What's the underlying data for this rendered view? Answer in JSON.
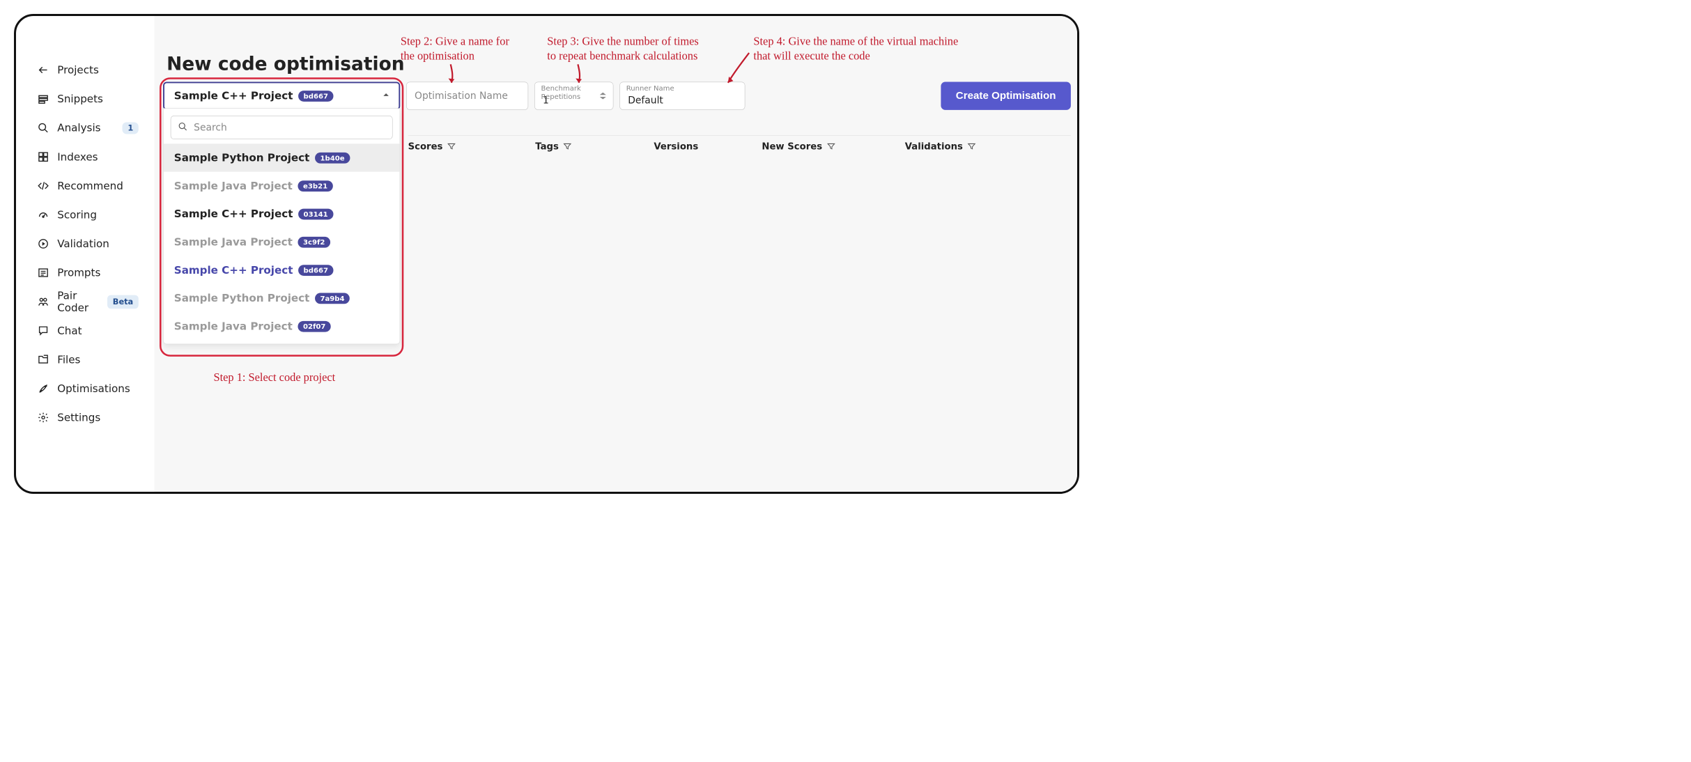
{
  "sidebar": {
    "items": [
      {
        "label": "Projects",
        "icon": "arrow-left"
      },
      {
        "label": "Snippets",
        "icon": "snippets"
      },
      {
        "label": "Analysis",
        "icon": "search",
        "badge": "1"
      },
      {
        "label": "Indexes",
        "icon": "indexes"
      },
      {
        "label": "Recommend",
        "icon": "code"
      },
      {
        "label": "Scoring",
        "icon": "gauge"
      },
      {
        "label": "Validation",
        "icon": "play-circle"
      },
      {
        "label": "Prompts",
        "icon": "prompts"
      },
      {
        "label": "Pair Coder",
        "icon": "pair",
        "beta": "Beta"
      },
      {
        "label": "Chat",
        "icon": "chat"
      },
      {
        "label": "Files",
        "icon": "files"
      },
      {
        "label": "Optimisations",
        "icon": "rocket"
      },
      {
        "label": "Settings",
        "icon": "gear"
      }
    ]
  },
  "page": {
    "title": "New code optimisation"
  },
  "select": {
    "current_label": "Sample C++ Project",
    "current_hash": "bd667",
    "search_placeholder": "Search",
    "options": [
      {
        "label": "Sample Python Project",
        "hash": "1b40e",
        "state": "highlight"
      },
      {
        "label": "Sample Java Project",
        "hash": "e3b21",
        "state": "dim"
      },
      {
        "label": "Sample C++ Project",
        "hash": "03141",
        "state": "normal"
      },
      {
        "label": "Sample Java Project",
        "hash": "3c9f2",
        "state": "dim"
      },
      {
        "label": "Sample C++ Project",
        "hash": "bd667",
        "state": "selected"
      },
      {
        "label": "Sample Python Project",
        "hash": "7a9b4",
        "state": "dim"
      },
      {
        "label": "Sample Java Project",
        "hash": "02f07",
        "state": "dim"
      }
    ]
  },
  "fields": {
    "opt_name_placeholder": "Optimisation Name",
    "bench_label": "Benchmark Repetitions",
    "bench_value": "1",
    "runner_label": "Runner Name",
    "runner_value": "Default"
  },
  "create_button": "Create Optimisation",
  "headers": {
    "scores": "Scores",
    "tags": "Tags",
    "versions": "Versions",
    "new_scores": "New Scores",
    "validations": "Validations"
  },
  "annotations": {
    "step1": "Step 1: Select code project",
    "step2a": "Step 2: Give a name for",
    "step2b": "the optimisation",
    "step3a": "Step 3: Give the number of times",
    "step3b": "to repeat benchmark calculations",
    "step4a": "Step 4: Give the name of the virtual machine",
    "step4b": "that will execute the code"
  }
}
